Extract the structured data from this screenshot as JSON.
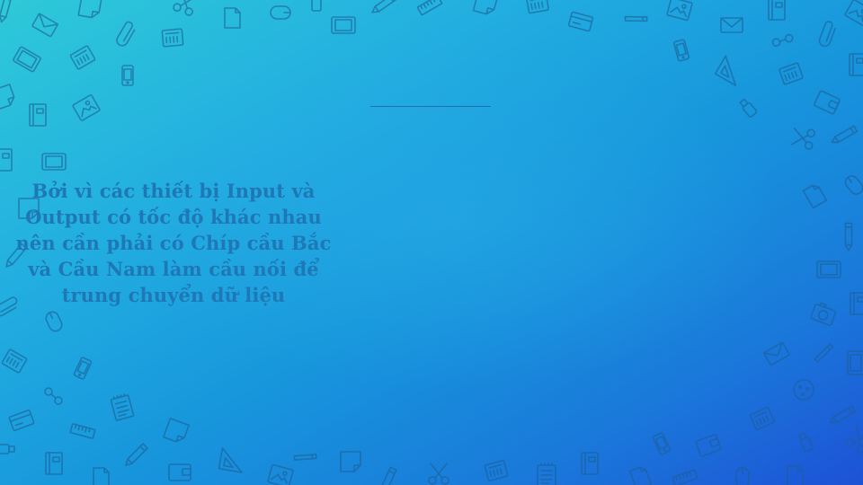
{
  "slide": {
    "body_text": "Bởi vì các thiết bị Input và Output có tốc độ khác nhau nên cần phải có Chíp cầu Bắc và Cầu Nam làm cầu nối để trung chuyển dữ liệu"
  },
  "colors": {
    "gradient_start": "#2ec9d8",
    "gradient_end": "#1d52d6",
    "icon_stroke": "#1d5f95",
    "text": "#1f78b6",
    "divider": "#1f5f9a"
  },
  "decoration": {
    "icon_names": [
      "pencil-icon",
      "envelope-icon",
      "notebook-icon",
      "document-icon",
      "phone-icon",
      "tablet-icon",
      "paperclip-icon",
      "scissors-icon",
      "ruler-icon",
      "triangle-ruler-icon",
      "photo-icon",
      "mouse-icon",
      "usb-icon",
      "sticky-note-icon",
      "card-icon",
      "cookie-icon",
      "glasses-icon",
      "camera-icon",
      "wallet-icon"
    ]
  }
}
